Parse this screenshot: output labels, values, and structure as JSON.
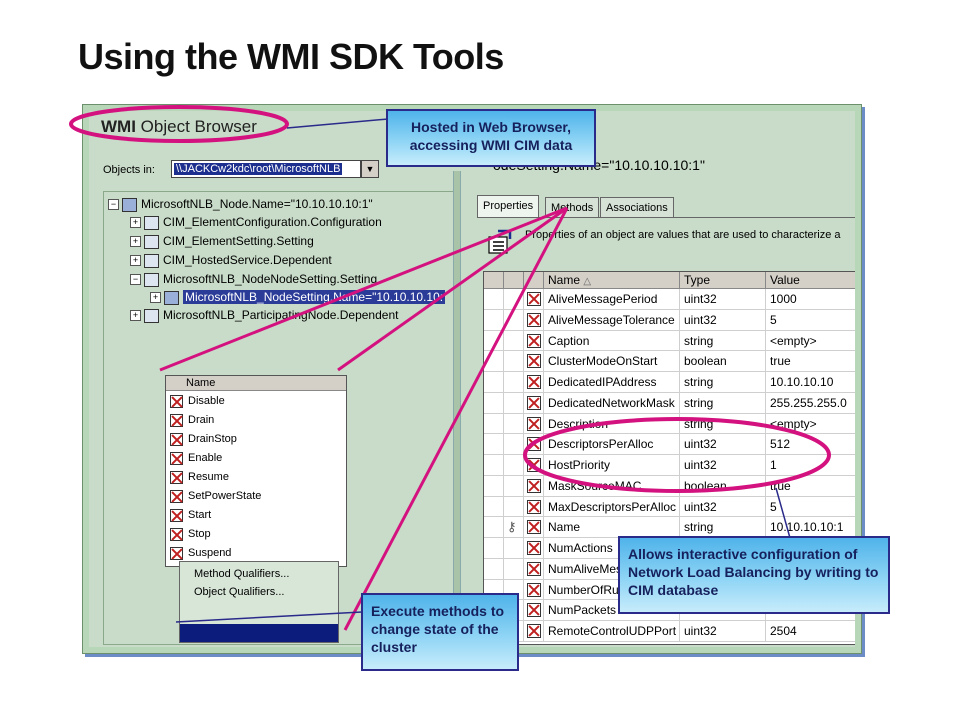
{
  "slide": {
    "title": "Using the WMI SDK Tools"
  },
  "browser": {
    "title_bold": "WMI",
    "title_rest": " Object Browser",
    "objects_label": "Objects in:",
    "objects_value": "\\\\JACKCw2kdc\\root\\MicrosoftNLB",
    "right_path": "odeSetting.Name=\"10.10.10.10:1\""
  },
  "tree": {
    "items": [
      {
        "pm": "−",
        "label": "MicrosoftNLB_Node.Name=\"10.10.10.10:1\""
      },
      {
        "pm": "+",
        "label": "CIM_ElementConfiguration.Configuration"
      },
      {
        "pm": "+",
        "label": "CIM_ElementSetting.Setting"
      },
      {
        "pm": "+",
        "label": "CIM_HostedService.Dependent"
      },
      {
        "pm": "−",
        "label": "MicrosoftNLB_NodeNodeSetting.Setting"
      },
      {
        "pm": "+",
        "label": "MicrosoftNLB_NodeSetting.Name=\"10.10.10.10:"
      },
      {
        "pm": "+",
        "label": "MicrosoftNLB_ParticipatingNode.Dependent"
      }
    ]
  },
  "tabs": [
    {
      "label": "Properties"
    },
    {
      "label": "Methods"
    },
    {
      "label": "Associations"
    }
  ],
  "properties": {
    "description": "Properties of an object are values that are used to characterize a",
    "columns": [
      "Name",
      "Type",
      "Value"
    ],
    "sort_indicator": "△",
    "rows": [
      {
        "name": "AliveMessagePeriod",
        "type": "uint32",
        "value": "1000"
      },
      {
        "name": "AliveMessageTolerance",
        "type": "uint32",
        "value": "5"
      },
      {
        "name": "Caption",
        "type": "string",
        "value": "<empty>"
      },
      {
        "name": "ClusterModeOnStart",
        "type": "boolean",
        "value": "true"
      },
      {
        "name": "DedicatedIPAddress",
        "type": "string",
        "value": "10.10.10.10"
      },
      {
        "name": "DedicatedNetworkMask",
        "type": "string",
        "value": "255.255.255.0"
      },
      {
        "name": "Description",
        "type": "string",
        "value": "<empty>"
      },
      {
        "name": "DescriptorsPerAlloc",
        "type": "uint32",
        "value": "512"
      },
      {
        "name": "HostPriority",
        "type": "uint32",
        "value": "1"
      },
      {
        "name": "MaskSourceMAC",
        "type": "boolean",
        "value": "true"
      },
      {
        "name": "MaxDescriptorsPerAlloc",
        "type": "uint32",
        "value": "5"
      },
      {
        "name": "Name",
        "type": "string",
        "value": "10.10.10.10:1"
      },
      {
        "name": "NumActions",
        "type": "",
        "value": ""
      },
      {
        "name": "NumAliveMes",
        "type": "",
        "value": ""
      },
      {
        "name": "NumberOfRul",
        "type": "",
        "value": ""
      },
      {
        "name": "NumPackets",
        "type": "",
        "value": ""
      },
      {
        "name": "RemoteControlUDPPort",
        "type": "uint32",
        "value": "2504"
      }
    ]
  },
  "methods": {
    "header": "Name",
    "items": [
      "Disable",
      "Drain",
      "DrainStop",
      "Enable",
      "Resume",
      "SetPowerState",
      "Start",
      "Stop",
      "Suspend"
    ]
  },
  "context_menu": {
    "items": [
      "Method Qualifiers...",
      "Object Qualifiers..."
    ]
  },
  "callouts": {
    "hosted": "Hosted in Web Browser, accessing WMI CIM data",
    "config": "Allows interactive configuration of Network Load Balancing by writing to CIM database",
    "exec": "Execute methods to change state of the cluster"
  },
  "colors": {
    "callout_line": "#d4127f",
    "selection": "#2a3c98",
    "callout_fill": "#8ed4f5"
  }
}
